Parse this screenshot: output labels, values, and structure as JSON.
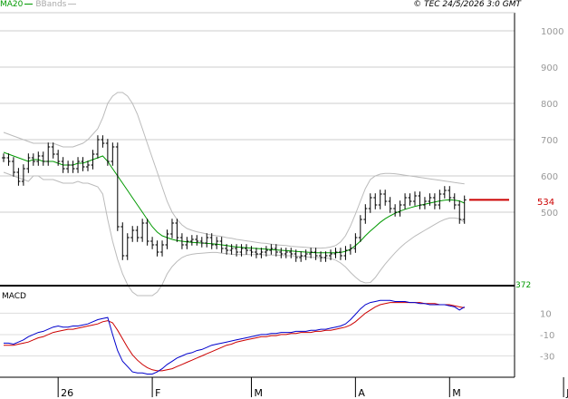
{
  "header": {
    "ma_label": "MA20",
    "bb_label": "BBands",
    "copyright": "© TEC 24/5/2026 3:0 GMT",
    "macd_label": "MACD",
    "last_price_label": "534"
  },
  "colors": {
    "ma": "#009900",
    "bands": "#bbbbbb",
    "price": "#000000",
    "macd": "#0000cc",
    "signal": "#cc0000",
    "last_price": "#cc0000",
    "grid": "#cccccc"
  },
  "chart_data": {
    "type": "line",
    "price_axis": {
      "ticks": [
        "1000",
        "900",
        "800",
        "700",
        "600",
        "500"
      ],
      "tick_values": [
        1000,
        900,
        800,
        700,
        600,
        500
      ],
      "extra_labels": [
        "372"
      ],
      "ylim": [
        300,
        1050
      ]
    },
    "macd_axis": {
      "ticks": [
        "10",
        "-10",
        "-30"
      ],
      "tick_values": [
        10,
        -10,
        -30
      ],
      "ylim": [
        -50,
        35
      ]
    },
    "x_labels": [
      {
        "text": "26",
        "index": 11
      },
      {
        "text": "F",
        "index": 30
      },
      {
        "text": "M",
        "index": 50
      },
      {
        "text": "A",
        "index": 71
      },
      {
        "text": "M",
        "index": 90
      },
      {
        "text": "J",
        "index": 113
      }
    ],
    "last_price": 534,
    "price": [
      650,
      640,
      610,
      585,
      620,
      650,
      640,
      655,
      640,
      680,
      660,
      640,
      620,
      630,
      620,
      640,
      625,
      630,
      660,
      700,
      690,
      640,
      680,
      460,
      380,
      430,
      450,
      430,
      470,
      420,
      410,
      390,
      410,
      440,
      470,
      430,
      410,
      420,
      425,
      420,
      415,
      430,
      410,
      420,
      400,
      395,
      400,
      390,
      400,
      395,
      390,
      385,
      390,
      395,
      400,
      390,
      385,
      390,
      385,
      375,
      380,
      385,
      390,
      380,
      375,
      380,
      385,
      390,
      380,
      395,
      400,
      430,
      480,
      510,
      540,
      520,
      550,
      530,
      510,
      500,
      520,
      540,
      530,
      545,
      520,
      530,
      540,
      520,
      550,
      560,
      540,
      520,
      480,
      534
    ],
    "ma20": [
      665,
      660,
      655,
      650,
      645,
      640,
      645,
      645,
      640,
      640,
      640,
      635,
      630,
      630,
      630,
      635,
      635,
      640,
      645,
      650,
      655,
      640,
      620,
      600,
      580,
      560,
      540,
      520,
      500,
      480,
      460,
      445,
      435,
      430,
      425,
      422,
      420,
      418,
      417,
      416,
      415,
      414,
      413,
      412,
      410,
      408,
      406,
      404,
      403,
      402,
      401,
      400,
      399,
      398,
      397,
      396,
      395,
      394,
      393,
      392,
      391,
      390,
      389,
      388,
      388,
      388,
      388,
      388,
      389,
      392,
      398,
      408,
      420,
      435,
      448,
      460,
      472,
      482,
      490,
      497,
      503,
      508,
      512,
      516,
      519,
      522,
      525,
      528,
      531,
      533,
      534,
      533,
      531,
      525
    ],
    "bb_upper": [
      720,
      715,
      710,
      705,
      700,
      695,
      690,
      690,
      690,
      690,
      690,
      685,
      680,
      680,
      680,
      685,
      690,
      700,
      715,
      730,
      760,
      800,
      820,
      830,
      830,
      820,
      800,
      770,
      730,
      690,
      650,
      610,
      570,
      530,
      500,
      480,
      465,
      455,
      450,
      446,
      443,
      440,
      437,
      435,
      433,
      430,
      428,
      425,
      423,
      421,
      419,
      417,
      415,
      414,
      412,
      410,
      409,
      408,
      406,
      405,
      404,
      403,
      402,
      401,
      401,
      402,
      404,
      408,
      418,
      435,
      462,
      495,
      530,
      565,
      590,
      600,
      605,
      607,
      607,
      606,
      604,
      602,
      600,
      598,
      596,
      594,
      592,
      590,
      588,
      586,
      584,
      582,
      580,
      578
    ],
    "bb_lower": [
      610,
      605,
      600,
      595,
      590,
      585,
      600,
      600,
      590,
      590,
      590,
      585,
      580,
      580,
      580,
      585,
      580,
      580,
      575,
      570,
      550,
      480,
      420,
      370,
      330,
      300,
      280,
      270,
      270,
      270,
      270,
      280,
      300,
      330,
      350,
      364,
      375,
      381,
      384,
      386,
      387,
      388,
      389,
      389,
      387,
      386,
      384,
      383,
      383,
      383,
      383,
      383,
      383,
      382,
      382,
      382,
      381,
      380,
      380,
      379,
      378,
      377,
      376,
      375,
      375,
      374,
      372,
      368,
      360,
      349,
      334,
      321,
      310,
      305,
      306,
      320,
      339,
      357,
      373,
      388,
      402,
      414,
      424,
      434,
      442,
      450,
      458,
      466,
      474,
      480,
      484,
      484,
      482,
      472
    ],
    "macd": [
      -18,
      -18,
      -19,
      -17,
      -15,
      -12,
      -10,
      -8,
      -7,
      -5,
      -3,
      -2,
      -3,
      -3,
      -2,
      -2,
      -1,
      0,
      2,
      4,
      5,
      6,
      -10,
      -25,
      -35,
      -40,
      -45,
      -46,
      -46,
      -47,
      -47,
      -45,
      -42,
      -38,
      -35,
      -32,
      -30,
      -28,
      -27,
      -25,
      -24,
      -22,
      -20,
      -19,
      -18,
      -17,
      -16,
      -15,
      -14,
      -13,
      -12,
      -11,
      -10,
      -10,
      -9,
      -9,
      -8,
      -8,
      -8,
      -7,
      -7,
      -7,
      -6,
      -6,
      -5,
      -5,
      -4,
      -3,
      -2,
      0,
      4,
      9,
      14,
      18,
      20,
      21,
      22,
      22,
      22,
      21,
      21,
      21,
      20,
      20,
      19,
      19,
      18,
      18,
      18,
      18,
      17,
      16,
      13,
      16
    ],
    "signal": [
      -20,
      -20,
      -20,
      -19,
      -18,
      -17,
      -15,
      -13,
      -12,
      -10,
      -8,
      -7,
      -6,
      -5,
      -5,
      -4,
      -3,
      -2,
      -1,
      0,
      2,
      3,
      1,
      -6,
      -14,
      -22,
      -29,
      -34,
      -38,
      -41,
      -43,
      -44,
      -44,
      -43,
      -42,
      -40,
      -38,
      -36,
      -34,
      -32,
      -30,
      -28,
      -26,
      -24,
      -22,
      -20,
      -19,
      -17,
      -16,
      -15,
      -14,
      -13,
      -12,
      -12,
      -11,
      -11,
      -10,
      -10,
      -9,
      -9,
      -8,
      -8,
      -8,
      -7,
      -7,
      -6,
      -6,
      -5,
      -4,
      -3,
      -1,
      2,
      6,
      10,
      13,
      16,
      18,
      19,
      20,
      20,
      20,
      20,
      20,
      20,
      20,
      19,
      19,
      19,
      18,
      18,
      18,
      17,
      16,
      15
    ]
  }
}
